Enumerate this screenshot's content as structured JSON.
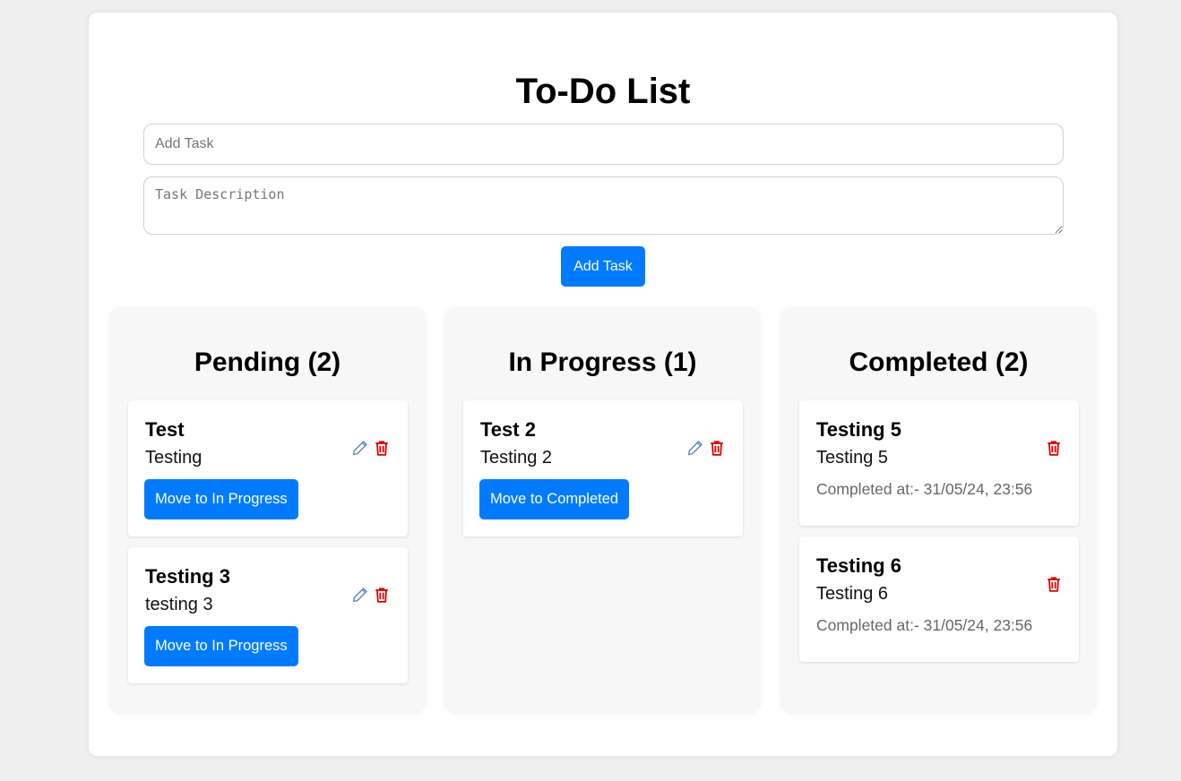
{
  "app": {
    "title": "To-Do List"
  },
  "form": {
    "task_placeholder": "Add Task",
    "description_placeholder": "Task Description",
    "add_button_label": "Add Task"
  },
  "columns": [
    {
      "title": "Pending",
      "count": "(2)",
      "tasks": [
        {
          "title": "Test",
          "description": "Testing",
          "action_label": "Move to In Progress"
        },
        {
          "title": "Testing 3",
          "description": "testing 3",
          "action_label": "Move to In Progress"
        }
      ]
    },
    {
      "title": "In Progress",
      "count": "(1)",
      "tasks": [
        {
          "title": "Test 2",
          "description": "Testing 2",
          "action_label": "Move to Completed"
        }
      ]
    },
    {
      "title": "Completed",
      "count": "(2)",
      "tasks": [
        {
          "title": "Testing 5",
          "description": "Testing 5",
          "completed_at": "Completed at:- 31/05/24, 23:56"
        },
        {
          "title": "Testing 6",
          "description": "Testing 6",
          "completed_at": "Completed at:- 31/05/24, 23:56"
        }
      ]
    }
  ],
  "icons": {
    "edit": "pencil-icon",
    "delete": "trash-icon"
  },
  "colors": {
    "accent": "#007bff",
    "delete": "#e00000",
    "edit": "#5a86b8",
    "background": "#efefef"
  }
}
